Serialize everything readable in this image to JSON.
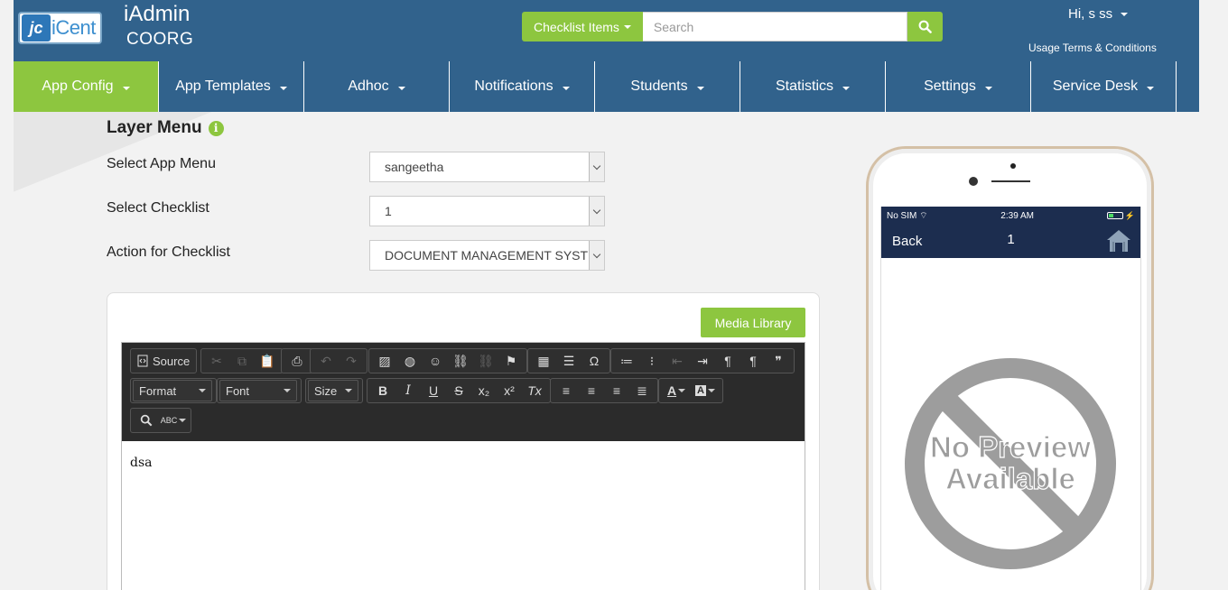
{
  "header": {
    "logo_text": "iCent",
    "logo_mark": "jc",
    "app_title": "iAdmin",
    "app_subtitle": "COORG",
    "search_dropdown": "Checklist Items",
    "search_placeholder": "Search",
    "user_greeting": "Hi, s ss",
    "terms_link": "Usage Terms & Conditions"
  },
  "nav": {
    "items": [
      {
        "label": "App Config"
      },
      {
        "label": "App Templates"
      },
      {
        "label": "Adhoc"
      },
      {
        "label": "Notifications"
      },
      {
        "label": "Students"
      },
      {
        "label": "Statistics"
      },
      {
        "label": "Settings"
      },
      {
        "label": "Service Desk"
      }
    ]
  },
  "form": {
    "title": "Layer Menu",
    "app_menu_label": "Select App Menu",
    "app_menu_value": "sangeetha",
    "checklist_label": "Select Checklist",
    "checklist_value": "1",
    "action_label": "Action for Checklist",
    "action_value": "DOCUMENT MANAGEMENT SYSTEM"
  },
  "editor": {
    "media_library": "Media Library",
    "source_label": "Source",
    "format_label": "Format",
    "font_label": "Font",
    "size_label": "Size",
    "content": "dsa"
  },
  "preview": {
    "carrier": "No SIM",
    "time": "2:39 AM",
    "back_label": "Back",
    "screen_title": "1",
    "no_preview_line1": "No Preview",
    "no_preview_line2": "Available"
  },
  "colors": {
    "header_bg": "#31628c",
    "accent_green": "#8dc63f",
    "phone_bar": "#1c2d4f"
  }
}
